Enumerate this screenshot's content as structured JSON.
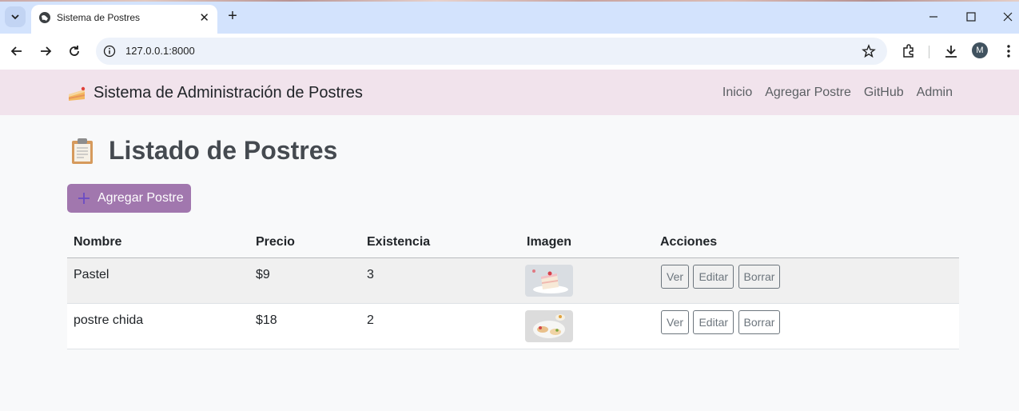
{
  "browser": {
    "tab_title": "Sistema de Postres",
    "url": "127.0.0.1:8000",
    "profile_initial": "M"
  },
  "navbar": {
    "brand": "Sistema de Administración de Postres",
    "links": [
      "Inicio",
      "Agregar Postre",
      "GitHub",
      "Admin"
    ]
  },
  "page": {
    "title": "Listado de Postres",
    "add_button": "Agregar Postre"
  },
  "table": {
    "headers": [
      "Nombre",
      "Precio",
      "Existencia",
      "Imagen",
      "Acciones"
    ],
    "rows": [
      {
        "nombre": "Pastel",
        "precio": "$9",
        "existencia": "3"
      },
      {
        "nombre": "postre chida",
        "precio": "$18",
        "existencia": "2"
      }
    ],
    "actions": [
      "Ver",
      "Editar",
      "Borrar"
    ]
  },
  "colors": {
    "navbar_bg": "#f1e3ec",
    "accent": "#a177ae",
    "chrome_bg": "#d3e3fd"
  }
}
